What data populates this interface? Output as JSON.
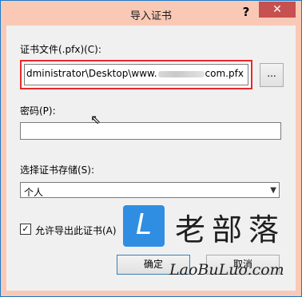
{
  "window": {
    "title": "导入证书",
    "help_label": "?",
    "close_label": "✕"
  },
  "file": {
    "label": "证书文件(.pfx)(C):",
    "value_prefix": "dministrator\\Desktop\\www.",
    "value_suffix": "com.pfx",
    "browse_label": "..."
  },
  "password": {
    "label": "密码(P):",
    "value": ""
  },
  "store": {
    "label": "选择证书存储(S):",
    "selected": "个人"
  },
  "export_checkbox": {
    "label": "允许导出此证书(A)",
    "checked": true
  },
  "buttons": {
    "ok": "确定",
    "cancel": "取消"
  },
  "watermark": {
    "badge": "L",
    "cn": "老部落",
    "en": "LaoBuLuo.com"
  }
}
